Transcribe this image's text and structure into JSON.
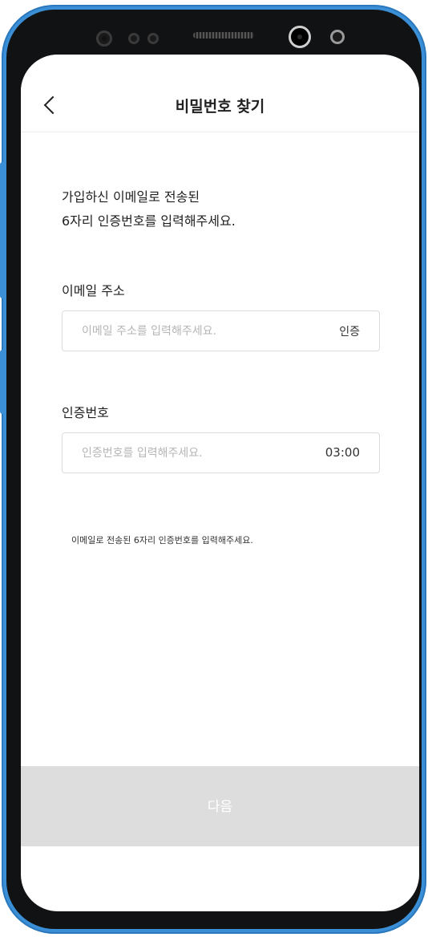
{
  "header": {
    "title": "비밀번호 찾기",
    "back_icon": "chevron-left-icon"
  },
  "intro": {
    "line1": "가입하신 이메일로 전송된",
    "line2": "6자리 인증번호를 입력해주세요."
  },
  "email": {
    "label": "이메일 주소",
    "placeholder": "이메일 주소를 입력해주세요.",
    "value": "",
    "action_label": "인증"
  },
  "code": {
    "label": "인증번호",
    "placeholder": "인증번호를 입력해주세요.",
    "value": "",
    "timer": "03:00",
    "helper": "이메일로 전송된 6자리 인증번호를 입력해주세요."
  },
  "footer": {
    "next_label": "다음"
  },
  "colors": {
    "device_frame": "#3a8fd6",
    "button_disabled": "#dddddd",
    "placeholder": "#b5b5b5"
  }
}
